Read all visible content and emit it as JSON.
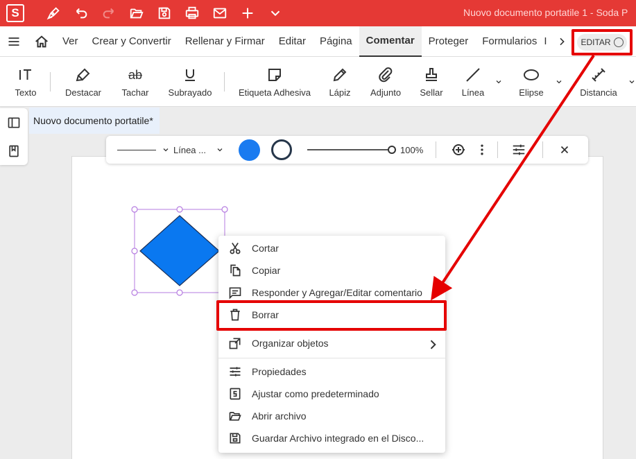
{
  "app": {
    "logo": "S",
    "title": "Nuovo documento portatile 1  -  Soda P"
  },
  "quick_access": [
    {
      "icon": "pen-icon"
    },
    {
      "icon": "undo-icon"
    },
    {
      "icon": "redo-icon"
    },
    {
      "icon": "folder-open-icon"
    },
    {
      "icon": "save-icon"
    },
    {
      "icon": "print-icon"
    },
    {
      "icon": "mail-icon"
    },
    {
      "icon": "plus-icon"
    },
    {
      "icon": "chevron-down-icon"
    }
  ],
  "menu": {
    "items": [
      "Ver",
      "Crear y Convertir",
      "Rellenar y Firmar",
      "Editar",
      "Página",
      "Comentar",
      "Proteger",
      "Formularios"
    ],
    "active": "Comentar",
    "more": "I",
    "editar_toggle": "EDITAR"
  },
  "toolbar": {
    "texto": "Texto",
    "destacar": "Destacar",
    "tachar": "Tachar",
    "subrayado": "Subrayado",
    "etiqueta": "Etiqueta Adhesiva",
    "lapiz": "Lápiz",
    "adjunto": "Adjunto",
    "sellar": "Sellar",
    "linea": "Línea",
    "elipse": "Elipse",
    "distancia": "Distancia",
    "tachar_glyph": "ab"
  },
  "doc_tab": "Nuovo documento portatile*",
  "propbar": {
    "line_style": "Línea ...",
    "opacity": "100%",
    "opacity_value": 100,
    "fill_color": "#1a7bf0",
    "stroke_color": "#26364a"
  },
  "shape": {
    "fill": "#0a78f0"
  },
  "context_menu": {
    "items": [
      {
        "label": "Cortar",
        "icon": "scissors-icon"
      },
      {
        "label": "Copiar",
        "icon": "copy-icon"
      },
      {
        "label": "Responder y Agregar/Editar comentario",
        "icon": "comment-icon"
      },
      {
        "label": "Borrar",
        "icon": "trash-icon"
      },
      {
        "label": "Organizar objetos",
        "icon": "arrange-icon"
      },
      {
        "label": "Propiedades",
        "icon": "sliders-icon"
      },
      {
        "label": "Ajustar como predeterminado",
        "icon": "default-icon"
      },
      {
        "label": "Abrir archivo",
        "icon": "folder-open-icon"
      },
      {
        "label": "Guardar Archivo integrado en el Disco...",
        "icon": "disk-save-icon"
      }
    ]
  },
  "colors": {
    "brand": "#e53935",
    "highlight": "#e50000"
  }
}
